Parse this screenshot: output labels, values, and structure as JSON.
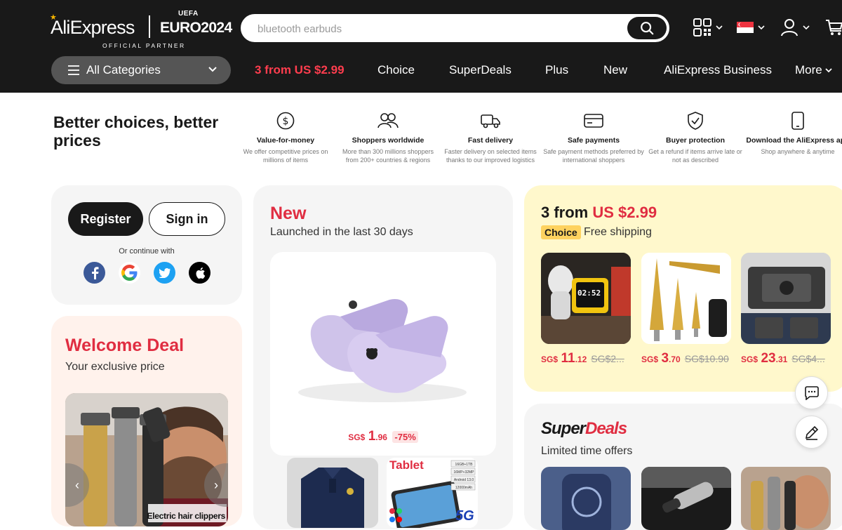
{
  "header": {
    "logo_text": "AliExpress",
    "logo_uefa": "UEFA",
    "logo_euro": "EURO2024",
    "logo_partner": "OFFICIAL PARTNER",
    "search_placeholder": "bluetooth earbuds",
    "all_categories": "All Categories",
    "nav": [
      "3 from US $2.99",
      "Choice",
      "SuperDeals",
      "Plus",
      "New",
      "AliExpress Business",
      "More"
    ]
  },
  "benefits": {
    "tagline": "Better choices, better prices",
    "items": [
      {
        "icon": "dollar-circle-icon",
        "title": "Value-for-money",
        "desc": "We offer competitive prices on millions of items"
      },
      {
        "icon": "people-icon",
        "title": "Shoppers worldwide",
        "desc": "More than 300 millions shoppers from 200+ countries & regions"
      },
      {
        "icon": "truck-icon",
        "title": "Fast delivery",
        "desc": "Faster delivery on selected items thanks to our improved logistics"
      },
      {
        "icon": "credit-card-icon",
        "title": "Safe payments",
        "desc": "Safe payment methods preferred by international shoppers"
      },
      {
        "icon": "shield-check-icon",
        "title": "Buyer protection",
        "desc": "Get a refund if items arrive late or not as described"
      },
      {
        "icon": "phone-icon",
        "title": "Download the AliExpress app",
        "desc": "Shop anywhere & anytime"
      }
    ]
  },
  "login": {
    "register": "Register",
    "sign_in": "Sign in",
    "or_continue": "Or continue with"
  },
  "welcome": {
    "title": "Welcome Deal",
    "subtitle": "Your exclusive price",
    "caption": "Electric hair clippers"
  },
  "new": {
    "title": "New",
    "subtitle": "Launched in the last 30 days",
    "main_price": {
      "currency": "SG$",
      "int": "1",
      "dec": ".96",
      "discount": "-75%"
    },
    "thumb_tablet_label": "Tablet",
    "tablet_specs": [
      "16GB+1TB",
      "16MP+32MP",
      "Android 13.0",
      "12000mAh"
    ],
    "tablet_5g": "5G"
  },
  "choice": {
    "title_prefix": "3 from ",
    "title_price": "US $2.99",
    "badge": "Choice",
    "free_shipping": "Free shipping",
    "items": [
      {
        "currency": "SG$",
        "int": "11",
        "dec": ".12",
        "old": "SG$2..."
      },
      {
        "currency": "SG$",
        "int": "3",
        "dec": ".70",
        "old": "SG$10.90"
      },
      {
        "currency": "SG$",
        "int": "23",
        "dec": ".31",
        "old": "SG$4..."
      }
    ],
    "clock_time": "02:52"
  },
  "superdeals": {
    "logo_super": "Super",
    "logo_deals": "Deals",
    "subtitle": "Limited time offers"
  },
  "colors": {
    "header_bg": "#191919",
    "accent_red": "#e02d41",
    "nav_red": "#ff3d4e",
    "choice_bg": "#fff8cc",
    "choice_badge": "#fed25f",
    "welcome_bg": "#fff2ec",
    "card_gray": "#f5f5f5"
  }
}
